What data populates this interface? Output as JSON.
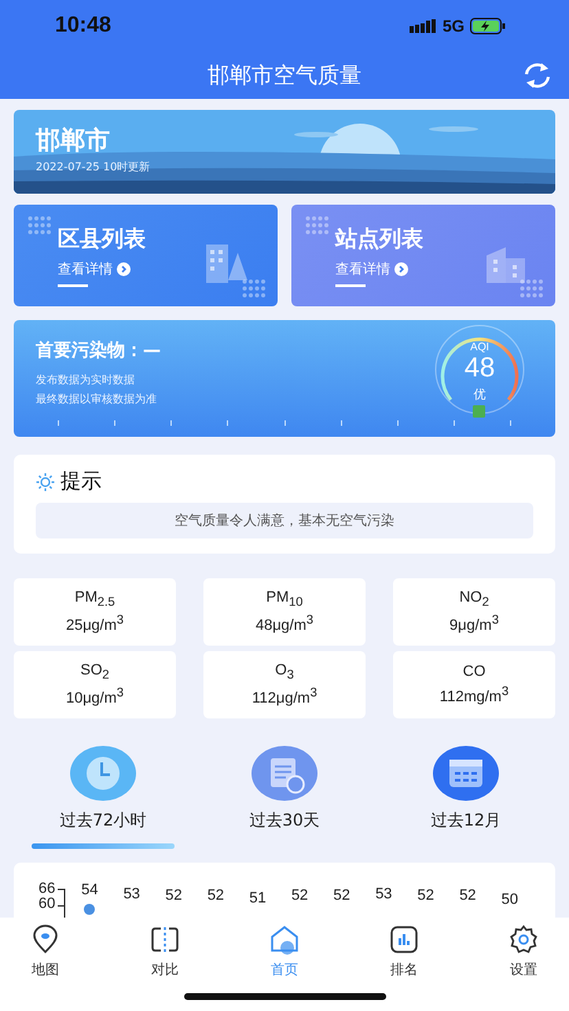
{
  "status_bar": {
    "time": "10:48",
    "network": "5G"
  },
  "header": {
    "title": "邯郸市空气质量"
  },
  "city_banner": {
    "name": "邯郸市",
    "updated": "2022-07-25 10时更新"
  },
  "list_cards": [
    {
      "title": "区县列表",
      "link": "查看详情",
      "kind": "district"
    },
    {
      "title": "站点列表",
      "link": "查看详情",
      "kind": "station"
    }
  ],
  "aqi_card": {
    "title": "首要污染物：—",
    "notes": [
      "发布数据为实时数据",
      "最终数据以审核数据为准"
    ],
    "aqi_label": "AQI",
    "aqi_value": "48",
    "grade": "优"
  },
  "tip": {
    "title": "提示",
    "message": "空气质量令人满意，基本无空气污染"
  },
  "pollutants": [
    {
      "name": "PM$_{2.5}$",
      "value": "25μg/m$^{3}$"
    },
    {
      "name": "PM$_{10}$",
      "value": "48μg/m$^{3}$"
    },
    {
      "name": "NO$_{2}$",
      "value": "9μg/m$^{3}$"
    },
    {
      "name": "SO$_{2}$",
      "value": "10μg/m$^{3}$"
    },
    {
      "name": "O$_{3}$",
      "value": "112μg/m$^{3}$"
    },
    {
      "name": "CO",
      "value": "112mg/m$^{3}$"
    }
  ],
  "periods": [
    {
      "label": "过去72小时",
      "kind": "clock",
      "selected": true
    },
    {
      "label": "过去30天",
      "kind": "calendar30",
      "selected": false
    },
    {
      "label": "过去12月",
      "kind": "calendar",
      "selected": false
    }
  ],
  "trend": {
    "axis_labels": [
      "66",
      "60"
    ],
    "value_labels": [
      "54",
      "53",
      "52",
      "52",
      "51",
      "52",
      "52",
      "53",
      "52",
      "52",
      "50"
    ]
  },
  "tab_bar": [
    {
      "label": "地图",
      "kind": "map",
      "selected": false
    },
    {
      "label": "对比",
      "kind": "compare",
      "selected": false
    },
    {
      "label": "首页",
      "kind": "home",
      "selected": true
    },
    {
      "label": "排名",
      "kind": "rank",
      "selected": false
    },
    {
      "label": "设置",
      "kind": "settings",
      "selected": false
    }
  ]
}
